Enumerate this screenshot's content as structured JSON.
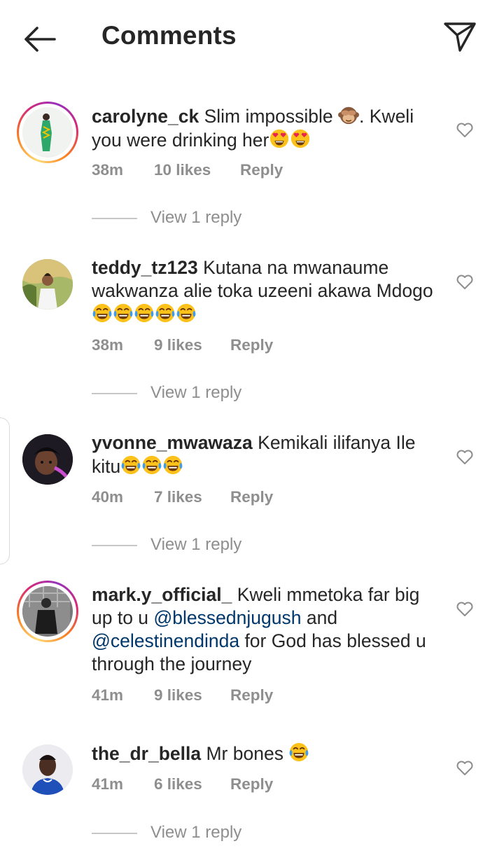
{
  "header": {
    "title": "Comments"
  },
  "icons": {
    "back": "arrow-left-icon",
    "send": "paper-plane-icon",
    "like": "heart-outline-icon"
  },
  "colors": {
    "mention": "#00376b",
    "meta": "#8e8e8e",
    "ring": "#d62976"
  },
  "comments": [
    {
      "username": "carolyne_ck",
      "text1": " Slim impossible ",
      "emoji1": "see-no-evil-monkey",
      "text2": ". Kweli you were drinking her",
      "emoji2": "heart-eyes x2",
      "time": "38m",
      "likes": "10 likes",
      "reply": "Reply",
      "view_replies": "View 1 reply"
    },
    {
      "username": "teddy_tz123",
      "text1": " Kutana na mwanaume wakwanza alie toka uzeeni akawa Mdogo ",
      "emoji1": "tears-of-joy x5",
      "time": "38m",
      "likes": "9 likes",
      "reply": "Reply",
      "view_replies": "View 1 reply"
    },
    {
      "username": "yvonne_mwawaza",
      "text1": " Kemikali ilifanya Ile kitu",
      "emoji1": "tears-of-joy x3",
      "time": "40m",
      "likes": "7 likes",
      "reply": "Reply",
      "view_replies": "View 1 reply"
    },
    {
      "username": "mark.y_official_",
      "text1": " Kweli mmetoka far big up to u ",
      "mention1": "@blessednjugush",
      "text2": " and ",
      "mention2": "@celestinendinda",
      "text3": " for God has blessed u through the journey",
      "time": "41m",
      "likes": "9 likes",
      "reply": "Reply"
    },
    {
      "username": "the_dr_bella",
      "text1": " Mr bones ",
      "emoji1": "tears-of-joy",
      "time": "41m",
      "likes": "6 likes",
      "reply": "Reply",
      "view_replies": "View 1 reply"
    }
  ]
}
